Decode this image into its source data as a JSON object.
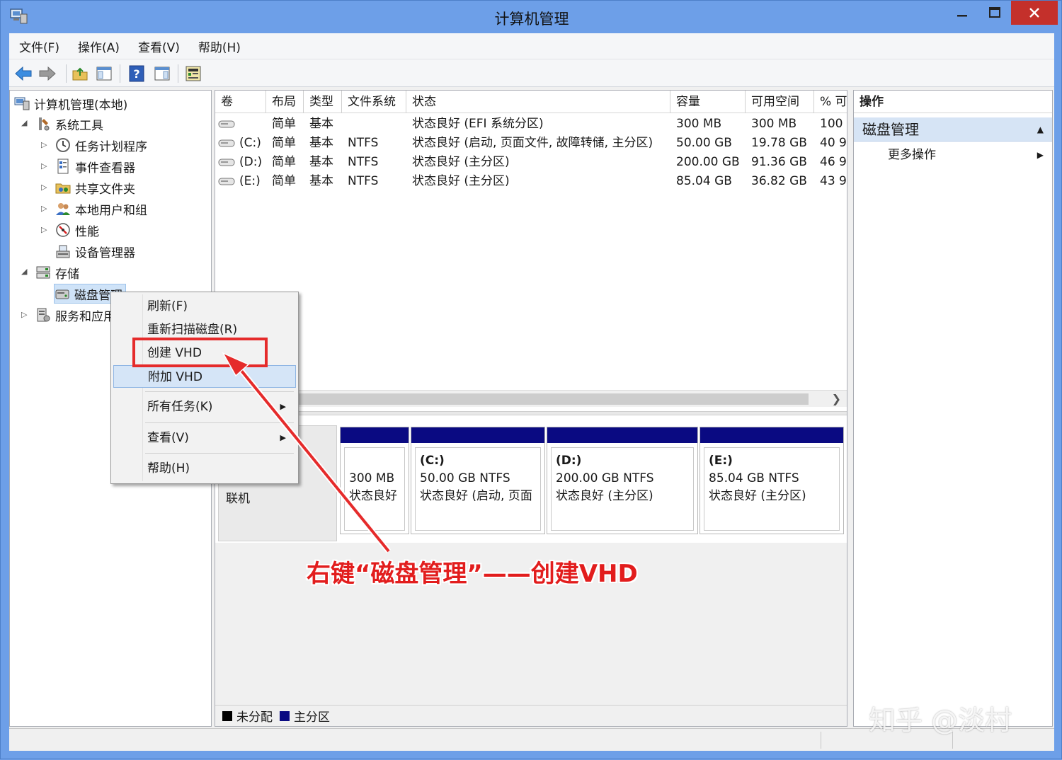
{
  "window": {
    "title": "计算机管理"
  },
  "menu": [
    "文件(F)",
    "操作(A)",
    "查看(V)",
    "帮助(H)"
  ],
  "tree": {
    "root": "计算机管理(本地)",
    "system_tools": "系统工具",
    "task_scheduler": "任务计划程序",
    "event_viewer": "事件查看器",
    "shared_folders": "共享文件夹",
    "local_users": "本地用户和组",
    "performance": "性能",
    "device_manager": "设备管理器",
    "storage": "存储",
    "disk_management": "磁盘管理",
    "services": "服务和应用程序"
  },
  "volume_table": {
    "headers": [
      "卷",
      "布局",
      "类型",
      "文件系统",
      "状态",
      "容量",
      "可用空间",
      "% 可"
    ],
    "rows": [
      {
        "vol": "",
        "layout": "简单",
        "type": "基本",
        "fs": "",
        "status": "状态良好 (EFI 系统分区)",
        "cap": "300 MB",
        "free": "300 MB",
        "pct": "100"
      },
      {
        "vol": "(C:)",
        "layout": "简单",
        "type": "基本",
        "fs": "NTFS",
        "status": "状态良好 (启动, 页面文件, 故障转储, 主分区)",
        "cap": "50.00 GB",
        "free": "19.78 GB",
        "pct": "40 9"
      },
      {
        "vol": "(D:)",
        "layout": "简单",
        "type": "基本",
        "fs": "NTFS",
        "status": "状态良好 (主分区)",
        "cap": "200.00 GB",
        "free": "91.36 GB",
        "pct": "46 9"
      },
      {
        "vol": "(E:)",
        "layout": "简单",
        "type": "基本",
        "fs": "NTFS",
        "status": "状态良好 (主分区)",
        "cap": "85.04 GB",
        "free": "36.82 GB",
        "pct": "43 9"
      }
    ]
  },
  "disk_graph": {
    "disk_status": "联机",
    "partitions": [
      {
        "name": "",
        "size": "300 MB",
        "status": "状态良好"
      },
      {
        "name": "(C:)",
        "size": "50.00 GB NTFS",
        "status": "状态良好 (启动, 页面"
      },
      {
        "name": "(D:)",
        "size": "200.00 GB NTFS",
        "status": "状态良好 (主分区)"
      },
      {
        "name": "(E:)",
        "size": "85.04 GB NTFS",
        "status": "状态良好 (主分区)"
      }
    ],
    "partition_color": "#0a0a82"
  },
  "legend": {
    "unallocated": "未分配",
    "primary": "主分区",
    "unallocated_color": "#000000",
    "primary_color": "#0a0a82"
  },
  "actions": {
    "header": "操作",
    "section": "磁盘管理",
    "more": "更多操作"
  },
  "context_menu": {
    "refresh": "刷新(F)",
    "rescan": "重新扫描磁盘(R)",
    "create_vhd": "创建 VHD",
    "attach_vhd": "附加 VHD",
    "all_tasks": "所有任务(K)",
    "view": "查看(V)",
    "help": "帮助(H)"
  },
  "annotation": {
    "text": "右键“磁盘管理”——创建VHD",
    "color": "#e21d1d"
  },
  "watermark": "知乎 @淡村"
}
